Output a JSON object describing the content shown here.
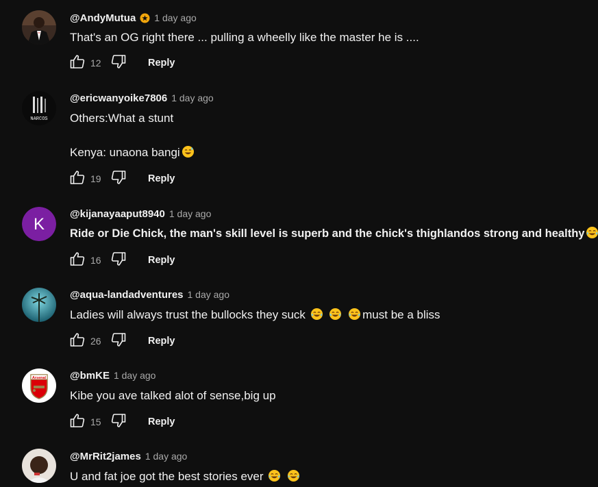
{
  "comments": [
    {
      "handle": "@AndyMutua",
      "verified": true,
      "time": "1 day ago",
      "lines": [
        "That's an OG right there ... pulling a wheelly like the master he is ...."
      ],
      "likes": "12",
      "reply_label": "Reply"
    },
    {
      "handle": "@ericwanyoike7806",
      "time": "1 day ago",
      "avatar_text": "NARCOS",
      "lines": [
        "Others:What a stunt",
        "Kenya: unaona bangi"
      ],
      "likes": "19",
      "reply_label": "Reply"
    },
    {
      "handle": "@kijanayaaput8940",
      "time": "1 day ago",
      "avatar_letter": "K",
      "avatar_color": "#7b1fa2",
      "lines": [
        "Ride or Die Chick, the man's skill level is superb and the chick's thighlandos strong and healthy",
        "."
      ],
      "likes": "16",
      "reply_label": "Reply"
    },
    {
      "handle": "@aqua-landadventures",
      "time": "1 day ago",
      "lines": [
        "Ladies will always trust the bullocks they suck",
        "must be a bliss"
      ],
      "likes": "26",
      "reply_label": "Reply"
    },
    {
      "handle": "@bmKE",
      "time": "1 day ago",
      "avatar_text": "Arsenal",
      "lines": [
        "Kibe you ave talked alot of sense,big up"
      ],
      "likes": "15",
      "reply_label": "Reply"
    },
    {
      "handle": "@MrRit2james",
      "time": "1 day ago",
      "lines": [
        "U and fat joe got the best stories ever"
      ]
    }
  ],
  "colors": {
    "background": "#0f0f0f",
    "text": "#f1f1f1",
    "muted": "#aaaaaa",
    "verified_badge": "#f2a60c"
  },
  "icons": [
    "thumbs-up-icon",
    "thumbs-down-icon",
    "verified-badge-icon",
    "grinning-sweat-emoji",
    "tears-of-joy-emoji"
  ]
}
